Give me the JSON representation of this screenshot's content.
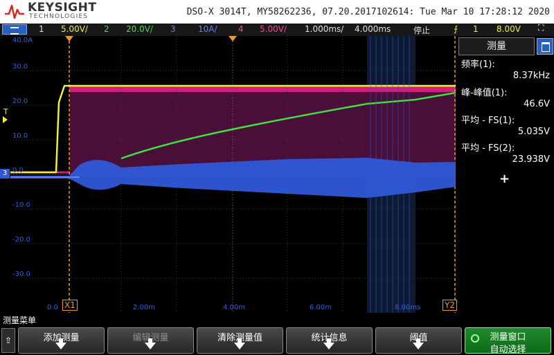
{
  "brand": {
    "name": "KEYSIGHT",
    "sub": "TECHNOLOGIES"
  },
  "header": {
    "info": "DSO-X 3014T, MY58262236, 07.20.2017102614: Tue Mar 10 17:28:12 2020"
  },
  "channels": {
    "ch1": {
      "num": "1",
      "scale": "5.00V/"
    },
    "ch2": {
      "num": "2",
      "scale": "20.0V/"
    },
    "ch3": {
      "num": "3",
      "scale": "10A/"
    },
    "ch4": {
      "num": "4",
      "scale": "5.00V/"
    },
    "timebase": "1.000ms/",
    "delay": "4.000ms",
    "run_state": "停止",
    "trigger_source": "1",
    "trigger_level": "8.00V"
  },
  "colors": {
    "ch1": "#f0f040",
    "ch2": "#40e040",
    "ch3": "#3a63e8",
    "ch4": "#d0207a"
  },
  "grid": {
    "y_ticks": [
      "40.0A",
      "30.0",
      "20.0",
      "10.0",
      "0.0",
      "-10.0",
      "-20.0",
      "-30.0",
      "0.0"
    ],
    "x_ticks": [
      "2.00m",
      "4.00m",
      "6.00m",
      "8.00ms"
    ],
    "cursor_x1": "X1",
    "cursor_x2": "Y2",
    "trigger_marker": "T",
    "ground_marker": "3"
  },
  "panel": {
    "title": "测量",
    "measurements": [
      {
        "label": "频率(1):",
        "value": "8.37kHz"
      },
      {
        "label": "峰-峰值(1):",
        "value": "46.6V"
      },
      {
        "label": "平均 - FS(1):",
        "value": "5.035V"
      },
      {
        "label": "平均 - FS(2):",
        "value": "23.938V"
      }
    ],
    "add_symbol": "+"
  },
  "softmenu": {
    "title": "测量菜单",
    "back": "⇧",
    "keys": [
      {
        "label": "添加测量"
      },
      {
        "label": "编辑测量"
      },
      {
        "label": "清除测量值"
      },
      {
        "label": "统计信息"
      },
      {
        "label": "阈值"
      }
    ],
    "window_key": {
      "line1": "测量窗口",
      "line2": "自动选择"
    }
  }
}
